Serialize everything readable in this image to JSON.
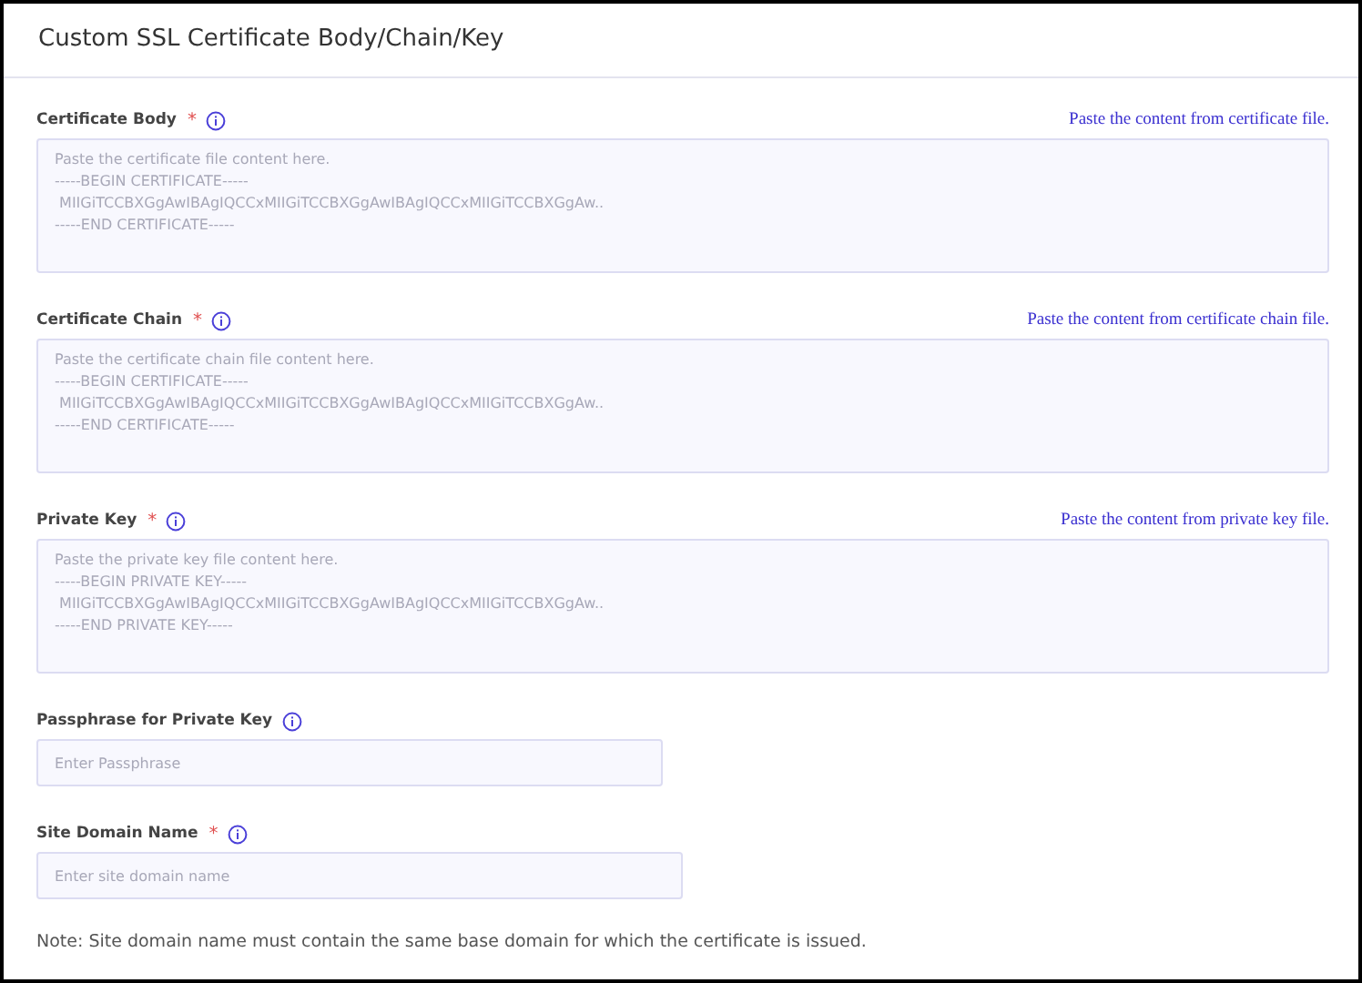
{
  "title": "Custom SSL Certificate Body/Chain/Key",
  "fields": [
    {
      "kind": "textarea",
      "label": "Certificate Body",
      "required_mark": "*",
      "hint": "Paste the content from certificate file.",
      "placeholder": "Paste the certificate file content here.\n-----BEGIN CERTIFICATE-----\n MIIGiTCCBXGgAwIBAgIQCCxMIIGiTCCBXGgAwIBAgIQCCxMIIGiTCCBXGgAw..\n-----END CERTIFICATE-----"
    },
    {
      "kind": "textarea",
      "label": "Certificate Chain",
      "required_mark": "*",
      "hint": "Paste the content from certificate chain file.",
      "placeholder": "Paste the certificate chain file content here.\n-----BEGIN CERTIFICATE-----\n MIIGiTCCBXGgAwIBAgIQCCxMIIGiTCCBXGgAwIBAgIQCCxMIIGiTCCBXGgAw..\n-----END CERTIFICATE-----"
    },
    {
      "kind": "textarea",
      "label": "Private Key",
      "required_mark": "*",
      "hint": "Paste the content from private key file.",
      "placeholder": "Paste the private key file content here.\n-----BEGIN PRIVATE KEY-----\n MIIGiTCCBXGgAwIBAgIQCCxMIIGiTCCBXGgAwIBAgIQCCxMIIGiTCCBXGgAw..\n-----END PRIVATE KEY-----"
    },
    {
      "kind": "input",
      "label": "Passphrase for Private Key",
      "placeholder": "Enter Passphrase"
    },
    {
      "kind": "input",
      "label": "Site Domain Name",
      "required_mark": "*",
      "placeholder": "Enter site domain name"
    }
  ],
  "note": "Note: Site domain name must contain the same base domain for which the certificate is issued."
}
